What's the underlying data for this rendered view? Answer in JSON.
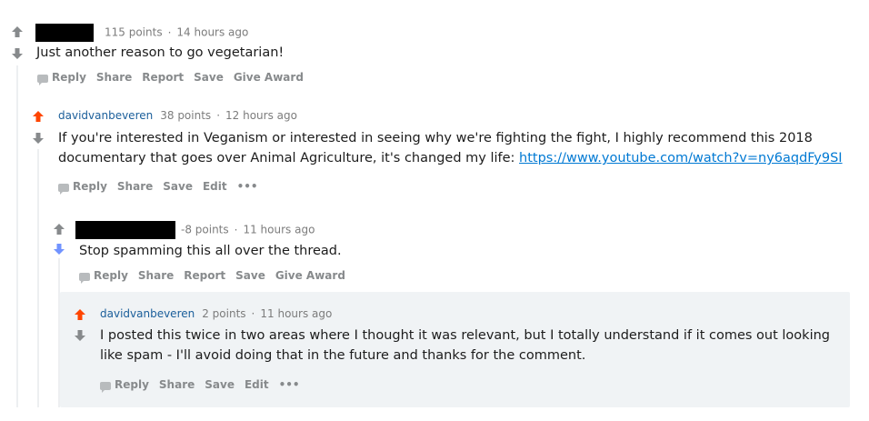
{
  "comments": [
    {
      "author": "",
      "points": "115 points",
      "sep": "·",
      "time": "14 hours ago",
      "body": "Just another reason to go vegetarian!",
      "actions": [
        "Reply",
        "Share",
        "Report",
        "Save",
        "Give Award"
      ]
    },
    {
      "author": "davidvanbeveren",
      "points": "38 points",
      "sep": "·",
      "time": "12 hours ago",
      "body_line1": "If you're interested in Veganism or interested in seeing why we're fighting the fight, I highly recommend this 2018",
      "body_line2": "documentary that goes over Animal Agriculture, it's changed my life: ",
      "link": "https://www.youtube.com/watch?v=ny6aqdFy9SI",
      "actions": [
        "Reply",
        "Share",
        "Save",
        "Edit",
        "•••"
      ]
    },
    {
      "author": "",
      "points": "-8 points",
      "sep": "·",
      "time": "11 hours ago",
      "body": "Stop spamming this all over the thread.",
      "actions": [
        "Reply",
        "Share",
        "Report",
        "Save",
        "Give Award"
      ]
    },
    {
      "author": "davidvanbeveren",
      "points": "2 points",
      "sep": "·",
      "time": "11 hours ago",
      "body_line1": "I posted this twice in two areas where I thought it was relevant, but I totally understand if it comes out looking",
      "body_line2": "like spam - I'll avoid doing that in the future and thanks for the comment.",
      "actions": [
        "Reply",
        "Share",
        "Save",
        "Edit",
        "•••"
      ]
    }
  ],
  "colors": {
    "upvote_active": "#ff4500",
    "downvote_active": "#7193ff",
    "arrow_neutral": "#878a8c",
    "author": "#1a5e9a",
    "link": "#0079d3"
  }
}
